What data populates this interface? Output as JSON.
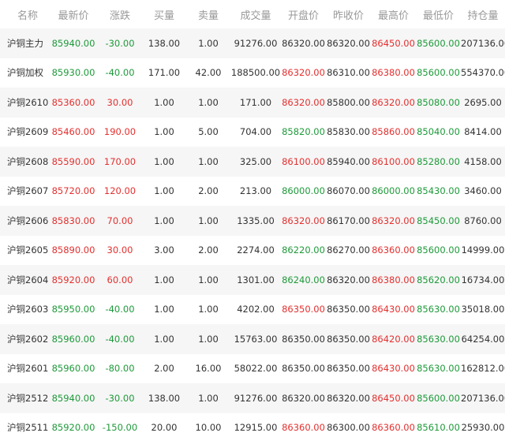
{
  "colors": {
    "up": "#e3302f",
    "down": "#1e9a3a",
    "text": "#333333",
    "header": "#999999"
  },
  "table": {
    "headers": [
      "名称",
      "最新价",
      "涨跌",
      "买量",
      "卖量",
      "成交量",
      "开盘价",
      "昨收价",
      "最高价",
      "最低价",
      "持仓量"
    ],
    "rows": [
      {
        "cells": [
          "沪铜主力",
          "85940.00",
          "-30.00",
          "138.00",
          "1.00",
          "91276.00",
          "86320.00",
          "86320.00",
          "86450.00",
          "85600.00",
          "207136.00"
        ],
        "tones": [
          "",
          "down",
          "down",
          "",
          "",
          "",
          "",
          "",
          "up",
          "down",
          ""
        ]
      },
      {
        "cells": [
          "沪铜加权",
          "85930.00",
          "-40.00",
          "171.00",
          "42.00",
          "188500.00",
          "86320.00",
          "86310.00",
          "86380.00",
          "85600.00",
          "554370.00"
        ],
        "tones": [
          "",
          "down",
          "down",
          "",
          "",
          "",
          "up",
          "",
          "up",
          "down",
          ""
        ]
      },
      {
        "cells": [
          "沪铜2610",
          "85360.00",
          "30.00",
          "1.00",
          "1.00",
          "171.00",
          "86320.00",
          "85800.00",
          "86320.00",
          "85080.00",
          "2695.00"
        ],
        "tones": [
          "",
          "up",
          "up",
          "",
          "",
          "",
          "up",
          "",
          "up",
          "down",
          ""
        ]
      },
      {
        "cells": [
          "沪铜2609",
          "85460.00",
          "190.00",
          "1.00",
          "5.00",
          "704.00",
          "85820.00",
          "85830.00",
          "85860.00",
          "85040.00",
          "8414.00"
        ],
        "tones": [
          "",
          "up",
          "up",
          "",
          "",
          "",
          "down",
          "",
          "up",
          "down",
          ""
        ]
      },
      {
        "cells": [
          "沪铜2608",
          "85590.00",
          "170.00",
          "1.00",
          "1.00",
          "325.00",
          "86100.00",
          "85940.00",
          "86100.00",
          "85280.00",
          "4158.00"
        ],
        "tones": [
          "",
          "up",
          "up",
          "",
          "",
          "",
          "up",
          "",
          "up",
          "down",
          ""
        ]
      },
      {
        "cells": [
          "沪铜2607",
          "85720.00",
          "120.00",
          "1.00",
          "2.00",
          "213.00",
          "86000.00",
          "86070.00",
          "86000.00",
          "85430.00",
          "3460.00"
        ],
        "tones": [
          "",
          "up",
          "up",
          "",
          "",
          "",
          "down",
          "",
          "down",
          "down",
          ""
        ]
      },
      {
        "cells": [
          "沪铜2606",
          "85830.00",
          "70.00",
          "1.00",
          "1.00",
          "1335.00",
          "86320.00",
          "86170.00",
          "86320.00",
          "85450.00",
          "8760.00"
        ],
        "tones": [
          "",
          "up",
          "up",
          "",
          "",
          "",
          "up",
          "",
          "up",
          "down",
          ""
        ]
      },
      {
        "cells": [
          "沪铜2605",
          "85890.00",
          "30.00",
          "3.00",
          "2.00",
          "2274.00",
          "86220.00",
          "86270.00",
          "86360.00",
          "85600.00",
          "14999.00"
        ],
        "tones": [
          "",
          "up",
          "up",
          "",
          "",
          "",
          "down",
          "",
          "up",
          "down",
          ""
        ]
      },
      {
        "cells": [
          "沪铜2604",
          "85920.00",
          "60.00",
          "1.00",
          "1.00",
          "1301.00",
          "86240.00",
          "86320.00",
          "86380.00",
          "85620.00",
          "16734.00"
        ],
        "tones": [
          "",
          "up",
          "up",
          "",
          "",
          "",
          "down",
          "",
          "up",
          "down",
          ""
        ]
      },
      {
        "cells": [
          "沪铜2603",
          "85950.00",
          "-40.00",
          "1.00",
          "1.00",
          "4202.00",
          "86350.00",
          "86350.00",
          "86430.00",
          "85630.00",
          "35018.00"
        ],
        "tones": [
          "",
          "down",
          "down",
          "",
          "",
          "",
          "up",
          "",
          "up",
          "down",
          ""
        ]
      },
      {
        "cells": [
          "沪铜2602",
          "85960.00",
          "-40.00",
          "1.00",
          "1.00",
          "15763.00",
          "86350.00",
          "86350.00",
          "86420.00",
          "85630.00",
          "64254.00"
        ],
        "tones": [
          "",
          "down",
          "down",
          "",
          "",
          "",
          "",
          "",
          "up",
          "down",
          ""
        ]
      },
      {
        "cells": [
          "沪铜2601",
          "85960.00",
          "-80.00",
          "2.00",
          "16.00",
          "58022.00",
          "86350.00",
          "86350.00",
          "86430.00",
          "85630.00",
          "162812.00"
        ],
        "tones": [
          "",
          "down",
          "down",
          "",
          "",
          "",
          "",
          "",
          "up",
          "down",
          ""
        ]
      },
      {
        "cells": [
          "沪铜2512",
          "85940.00",
          "-30.00",
          "138.00",
          "1.00",
          "91276.00",
          "86320.00",
          "86320.00",
          "86450.00",
          "85600.00",
          "207136.00"
        ],
        "tones": [
          "",
          "down",
          "down",
          "",
          "",
          "",
          "",
          "",
          "up",
          "down",
          ""
        ]
      },
      {
        "cells": [
          "沪铜2511",
          "85920.00",
          "-150.00",
          "20.00",
          "10.00",
          "12915.00",
          "86360.00",
          "86300.00",
          "86360.00",
          "85610.00",
          "25930.00"
        ],
        "tones": [
          "",
          "down",
          "down",
          "",
          "",
          "",
          "up",
          "",
          "up",
          "down",
          ""
        ]
      }
    ]
  }
}
